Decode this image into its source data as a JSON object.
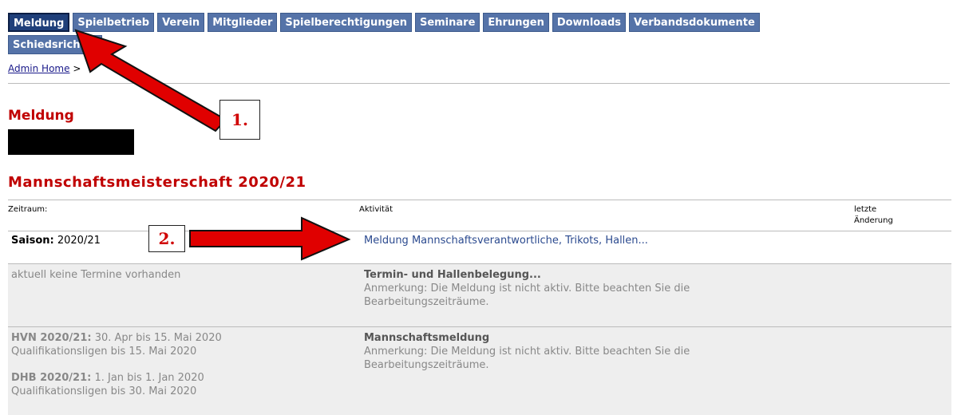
{
  "nav": {
    "row1": [
      "Meldung",
      "Spielbetrieb",
      "Verein",
      "Mitglieder",
      "Spielberechtigungen",
      "Seminare",
      "Ehrungen",
      "Downloads",
      "Verbandsdokumente"
    ],
    "row2": [
      "Schiedsrichter"
    ]
  },
  "breadcrumb": {
    "home": "Admin Home",
    "sep": ">"
  },
  "page_title": "Meldung",
  "section_title": "Mannschaftsmeisterschaft  2020/21",
  "table": {
    "headers": {
      "zeitraum": "Zeitraum:",
      "aktivitaet": "Aktivität",
      "letzte": "letzte",
      "aenderung": "Änderung"
    },
    "row1": {
      "label": "Saison:",
      "value": "2020/21",
      "link": "Meldung Mannschaftsverantwortliche, Trikots, Hallen..."
    },
    "row2": {
      "zeitraum": "aktuell keine Termine vorhanden",
      "title": "Termin- und Hallenbelegung...",
      "note1": "Anmerkung: Die Meldung ist nicht aktiv. Bitte beachten Sie die",
      "note2": "Bearbeitungszeiträume."
    },
    "row3": {
      "hvn_label": "HVN 2020/21:",
      "hvn_range": "30. Apr bis 15. Mai 2020",
      "hvn_quali": "Qualifikationsligen bis 15. Mai 2020",
      "dhb_label": "DHB 2020/21:",
      "dhb_range": "1. Jan bis 1. Jan 2020",
      "dhb_quali": "Qualifikationsligen bis 30. Mai 2020",
      "title": "Mannschaftsmeldung",
      "note1": "Anmerkung: Die Meldung ist nicht aktiv. Bitte beachten Sie die",
      "note2": "Bearbeitungszeiträume."
    }
  },
  "annotations": {
    "step1": "1.",
    "step2": "2."
  },
  "colors": {
    "tab": "#5573a8",
    "tab_active": "#1f3f7a",
    "title_red": "#c00000",
    "arrow": "#e00000"
  }
}
